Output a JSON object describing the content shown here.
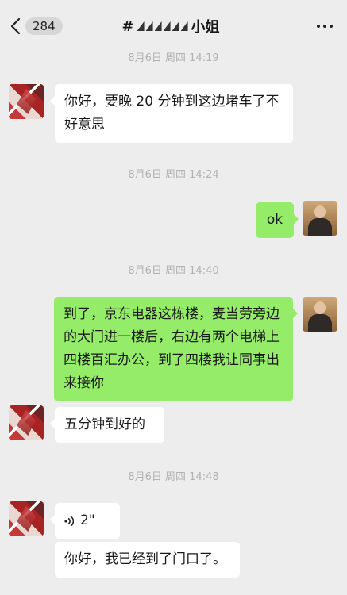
{
  "header": {
    "back_count": "284",
    "title_prefix": "#",
    "title_suffix": "小姐"
  },
  "messages": [
    {
      "time": "8月6日 周四 14:19"
    },
    {
      "from": "contact",
      "text": "你好，要晚 20 分钟到这边堵车了不好意思"
    },
    {
      "time": "8月6日 周四 14:24"
    },
    {
      "from": "me",
      "text": "ok"
    },
    {
      "time": "8月6日 周四 14:40"
    },
    {
      "from": "me",
      "text": "到了，京东电器这栋楼，麦当劳旁边的大门进一楼后，右边有两个电梯上四楼百汇办公，到了四楼我让同事出来接你"
    },
    {
      "from": "contact",
      "text": "五分钟到好的"
    },
    {
      "time": "8月6日 周四 14:48"
    },
    {
      "from": "contact",
      "type": "voice",
      "duration": "2\""
    },
    {
      "from": "contact",
      "text": "你好，我已经到了门口了。"
    }
  ],
  "colors": {
    "background": "#ededed",
    "bubble_me": "#95ec69",
    "bubble_contact": "#ffffff",
    "timestamp": "#b2b2b2"
  },
  "icons": [
    "chevron-left-icon",
    "more-dots-icon",
    "voice-wave-icon"
  ]
}
